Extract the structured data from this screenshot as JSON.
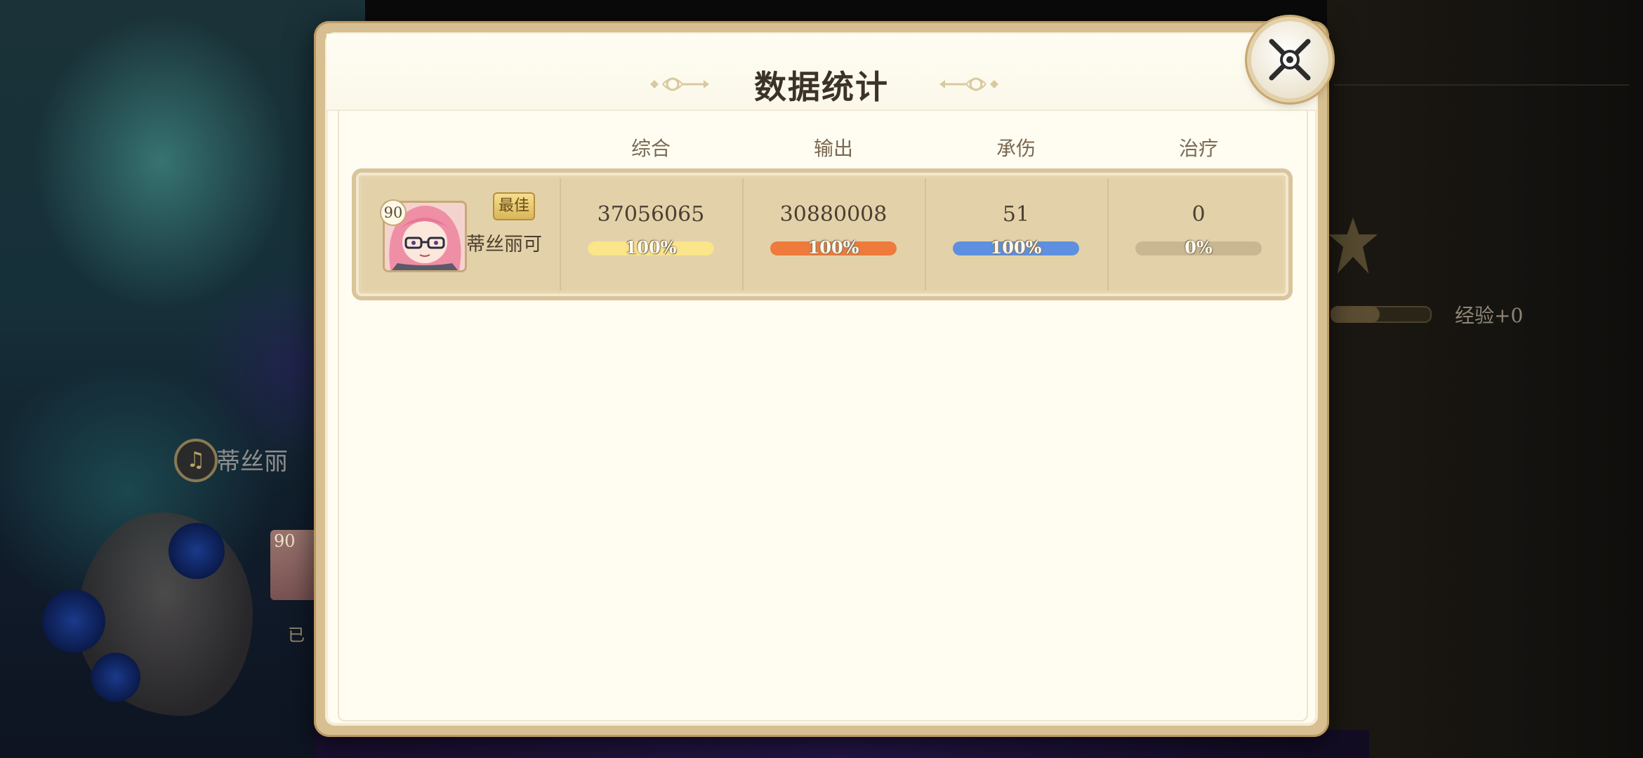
{
  "background": {
    "left_character_name": "蒂丝丽",
    "left_card_level": "90",
    "left_card_tag": "已",
    "exp_text": "经验+0"
  },
  "modal": {
    "title": "数据统计",
    "close_icon": "close-icon"
  },
  "table": {
    "headers": [
      "综合",
      "输出",
      "承伤",
      "治疗"
    ],
    "rows": [
      {
        "level": "90",
        "badge": "最佳",
        "name": "蒂丝丽可",
        "stats": [
          {
            "value": "37056065",
            "percent_label": "100%",
            "percent": 1.0,
            "color": "#fae58a"
          },
          {
            "value": "30880008",
            "percent_label": "100%",
            "percent": 1.0,
            "color": "#ee7a3c"
          },
          {
            "value": "51",
            "percent_label": "100%",
            "percent": 1.0,
            "color": "#5f8fe0"
          },
          {
            "value": "0",
            "percent_label": "0%",
            "percent": 0.0,
            "color": "#c8b791"
          }
        ]
      }
    ]
  }
}
